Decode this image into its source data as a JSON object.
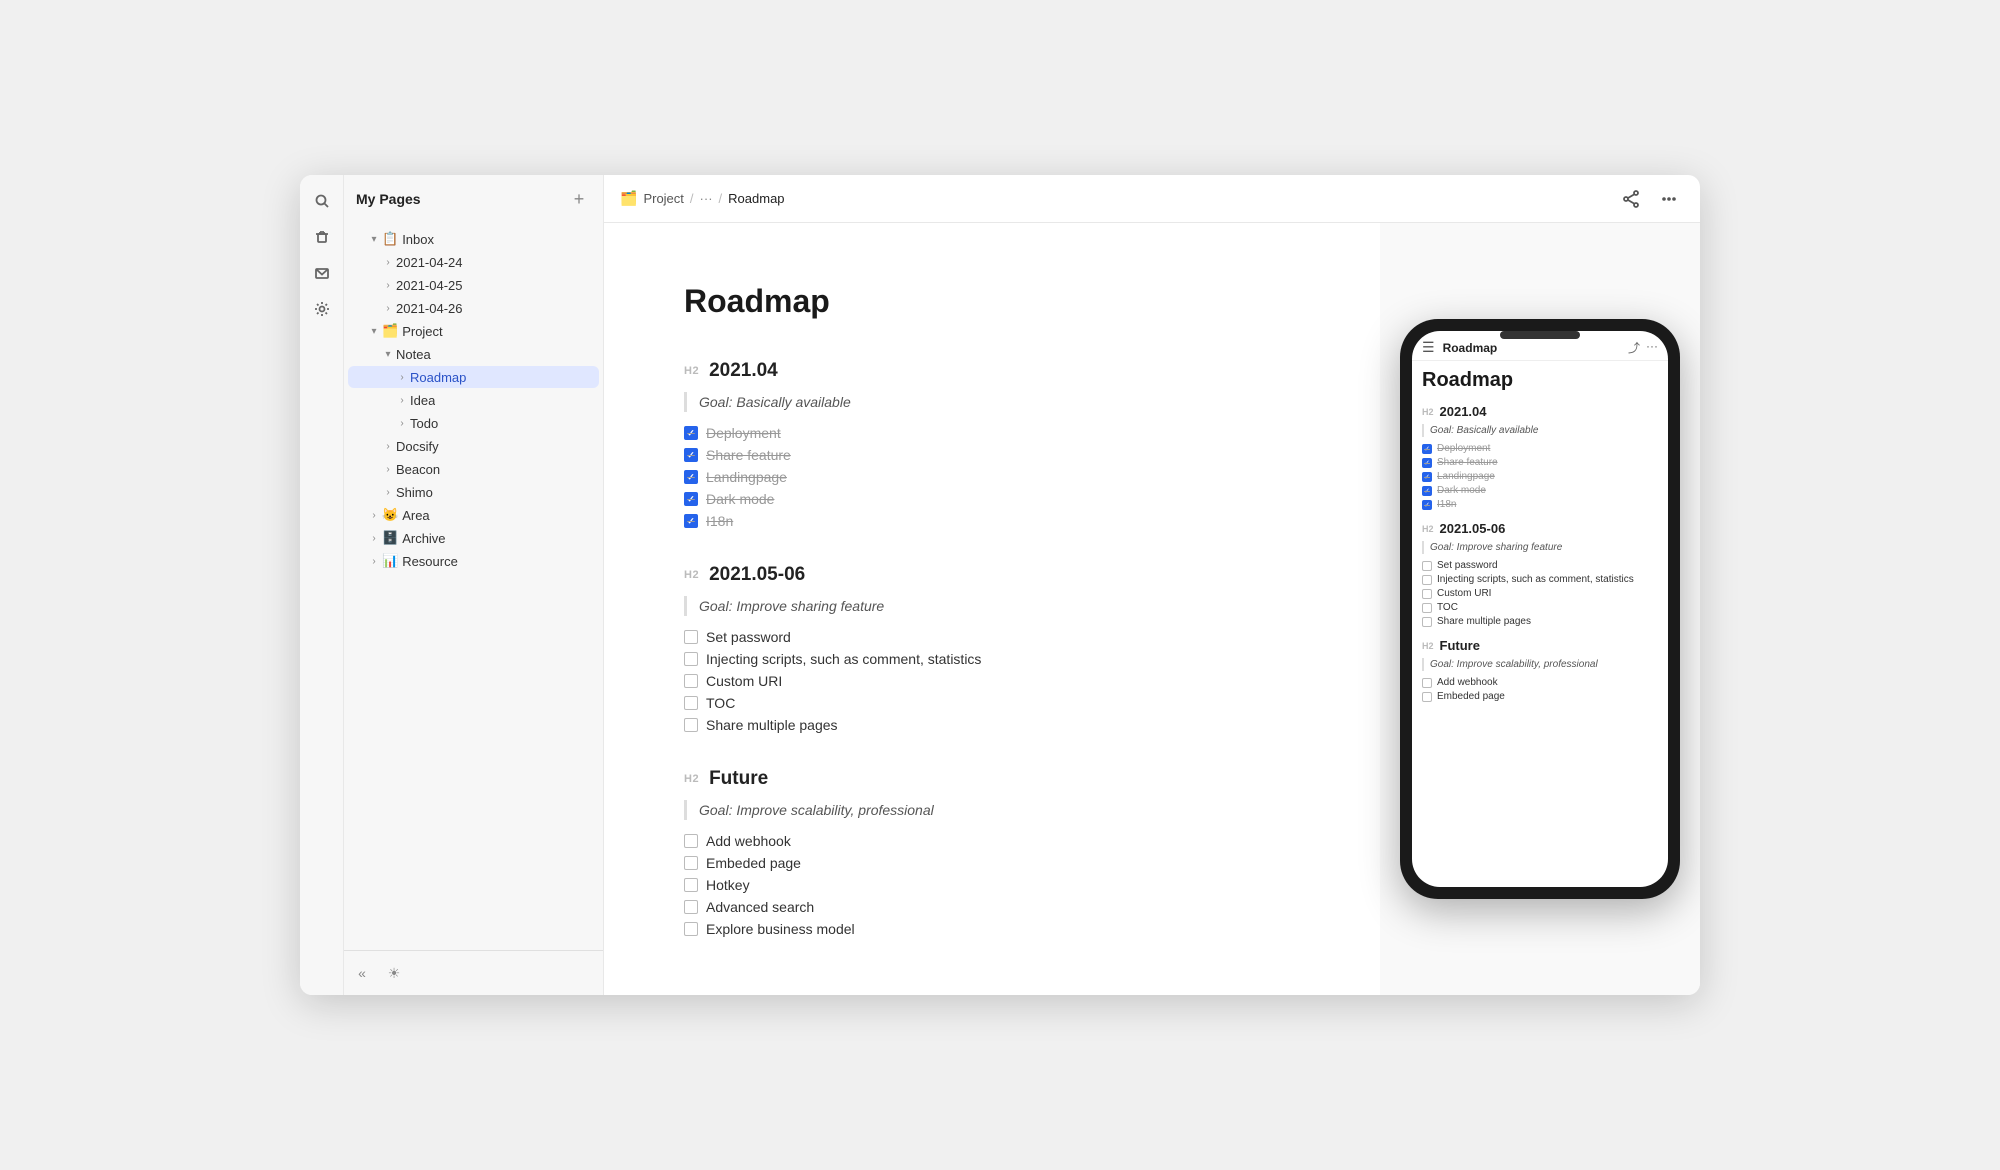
{
  "app": {
    "title": "My Pages",
    "window_title": "Roadmap"
  },
  "sidebar": {
    "title": "My Pages",
    "add_button_label": "+",
    "tree": [
      {
        "id": "inbox",
        "label": "Inbox",
        "icon": "📋",
        "level": 0,
        "expanded": true,
        "chevron": "down"
      },
      {
        "id": "2021-04-24",
        "label": "2021-04-24",
        "icon": "",
        "level": 1,
        "chevron": "right"
      },
      {
        "id": "2021-04-25",
        "label": "2021-04-25",
        "icon": "",
        "level": 1,
        "chevron": "right"
      },
      {
        "id": "2021-04-26",
        "label": "2021-04-26",
        "icon": "",
        "level": 1,
        "chevron": "right"
      },
      {
        "id": "project",
        "label": "Project",
        "icon": "🗂️",
        "level": 0,
        "expanded": true,
        "chevron": "down"
      },
      {
        "id": "notea",
        "label": "Notea",
        "icon": "",
        "level": 1,
        "expanded": true,
        "chevron": "down"
      },
      {
        "id": "roadmap",
        "label": "Roadmap",
        "icon": "",
        "level": 2,
        "active": true,
        "chevron": "right"
      },
      {
        "id": "idea",
        "label": "Idea",
        "icon": "",
        "level": 2,
        "chevron": "right"
      },
      {
        "id": "todo",
        "label": "Todo",
        "icon": "",
        "level": 2,
        "chevron": "right"
      },
      {
        "id": "docsify",
        "label": "Docsify",
        "icon": "",
        "level": 1,
        "chevron": "right"
      },
      {
        "id": "beacon",
        "label": "Beacon",
        "icon": "",
        "level": 1,
        "chevron": "right"
      },
      {
        "id": "shimo",
        "label": "Shimo",
        "icon": "",
        "level": 1,
        "chevron": "right"
      },
      {
        "id": "area",
        "label": "Area",
        "icon": "😺",
        "level": 0,
        "chevron": "right"
      },
      {
        "id": "archive",
        "label": "Archive",
        "icon": "🗄️",
        "level": 0,
        "chevron": "right"
      },
      {
        "id": "resource",
        "label": "Resource",
        "icon": "📊",
        "level": 0,
        "chevron": "right"
      }
    ],
    "collapse_label": "«",
    "theme_label": "☀"
  },
  "breadcrumb": {
    "project_icon": "🗂️",
    "project_label": "Project",
    "separator1": "/",
    "more": "···",
    "separator2": "/",
    "current": "Roadmap"
  },
  "topbar": {
    "share_icon": "share",
    "more_icon": "more"
  },
  "document": {
    "title": "Roadmap",
    "sections": [
      {
        "id": "2021.04",
        "h2_label": "H2",
        "h2_text": "2021.04",
        "quote": "Goal: Basically available",
        "items": [
          {
            "text": "Deployment",
            "checked": true
          },
          {
            "text": "Share feature",
            "checked": true
          },
          {
            "text": "Landingpage",
            "checked": true
          },
          {
            "text": "Dark mode",
            "checked": true
          },
          {
            "text": "I18n",
            "checked": true
          }
        ]
      },
      {
        "id": "2021.05-06",
        "h2_label": "H2",
        "h2_text": "2021.05-06",
        "quote": "Goal: Improve sharing feature",
        "items": [
          {
            "text": "Set password",
            "checked": false
          },
          {
            "text": "Injecting scripts, such as comment, statistics",
            "checked": false
          },
          {
            "text": "Custom URI",
            "checked": false
          },
          {
            "text": "TOC",
            "checked": false
          },
          {
            "text": "Share multiple pages",
            "checked": false
          }
        ]
      },
      {
        "id": "future",
        "h2_label": "H2",
        "h2_text": "Future",
        "quote": "Goal: Improve scalability, professional",
        "items": [
          {
            "text": "Add webhook",
            "checked": false
          },
          {
            "text": "Embeded page",
            "checked": false
          },
          {
            "text": "Hotkey",
            "checked": false
          },
          {
            "text": "Advanced search",
            "checked": false
          },
          {
            "text": "Explore business model",
            "checked": false
          }
        ]
      }
    ]
  },
  "phone_preview": {
    "title": "Roadmap",
    "doc_title": "Roadmap",
    "sections": [
      {
        "h2_label": "H2",
        "h2_text": "2021.04",
        "quote": "Goal: Basically available",
        "items": [
          {
            "text": "Deployment",
            "checked": true
          },
          {
            "text": "Share feature",
            "checked": true
          },
          {
            "text": "Landingpage",
            "checked": true
          },
          {
            "text": "Dark mode",
            "checked": true
          },
          {
            "text": "I18n",
            "checked": true
          }
        ]
      },
      {
        "h2_label": "H2",
        "h2_text": "2021.05-06",
        "quote": "Goal: Improve sharing feature",
        "items": [
          {
            "text": "Set password",
            "checked": false
          },
          {
            "text": "Injecting scripts, such as comment, statistics",
            "checked": false
          },
          {
            "text": "Custom URI",
            "checked": false
          },
          {
            "text": "TOC",
            "checked": false
          },
          {
            "text": "Share multiple pages",
            "checked": false
          }
        ]
      },
      {
        "h2_label": "H2",
        "h2_text": "Future",
        "quote": "Goal: Improve scalability, professional",
        "items": [
          {
            "text": "Add webhook",
            "checked": false
          },
          {
            "text": "Embeded page",
            "checked": false
          }
        ]
      }
    ]
  }
}
